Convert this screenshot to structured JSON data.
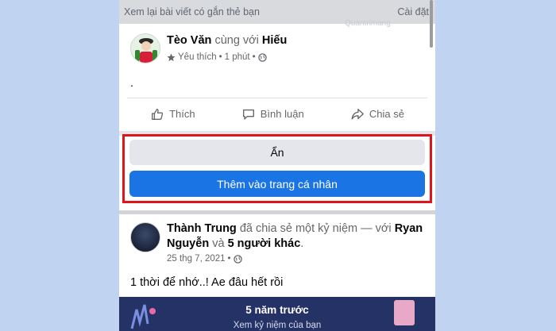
{
  "topbar": {
    "title": "Xem lại bài viết có gắn thẻ bạn",
    "settings": "Cài đặt"
  },
  "watermark": "Quantrimang",
  "post1": {
    "author": "Tèo Văn",
    "with_text": "cùng với",
    "tagged": "Hiếu",
    "meta_feeling": "Yêu thích",
    "meta_sep": "•",
    "meta_time": "1 phút",
    "meta_sep2": "•",
    "body": "."
  },
  "actions": {
    "like": "Thích",
    "comment": "Bình luận",
    "share": "Chia sẻ"
  },
  "buttons": {
    "hide": "Ẩn",
    "add_to_profile": "Thêm vào trang cá nhân"
  },
  "post2": {
    "author": "Thành Trung",
    "shared_text": "đã chia sẻ một kỷ niệm — với",
    "tag1": "Ryan Nguyễn",
    "and_text": "và",
    "others": "5 người khác",
    "period": ".",
    "date": "25 thg 7, 2021",
    "meta_sep": "•",
    "body": "1 thời để nhớ..! Ae đâu hết rồi"
  },
  "memory": {
    "title": "5 năm trước",
    "subtitle": "Xem kỷ niệm của bạn"
  },
  "colors": {
    "primary": "#1b74e4",
    "highlight": "#e0141c",
    "memory_bg": "#243266"
  }
}
